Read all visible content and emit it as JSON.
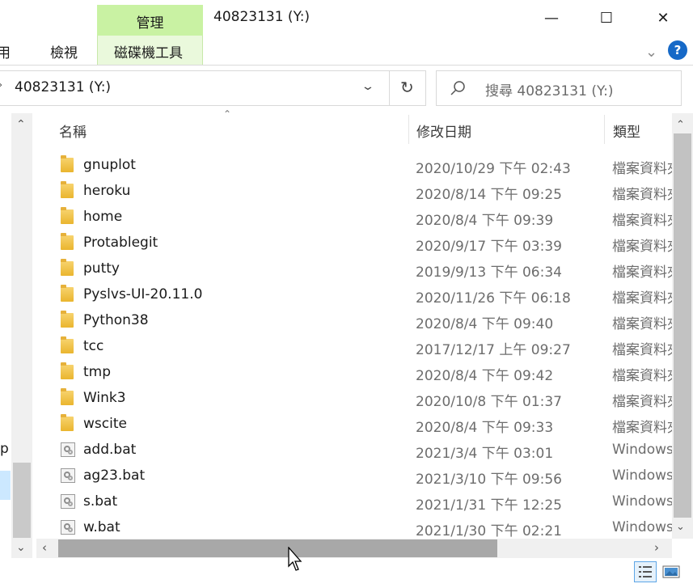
{
  "window": {
    "title": "40823131 (Y:)",
    "context_tab": "管理",
    "minimize": "—",
    "maximize": "☐",
    "close": "✕"
  },
  "ribbon": {
    "tabs": [
      "用",
      "檢視",
      "磁碟機工具"
    ],
    "expand": "⌄",
    "help": "?"
  },
  "address": {
    "chevron": "›",
    "path": "40823131 (Y:)",
    "dropdown": "⌄",
    "refresh": "↻"
  },
  "search": {
    "placeholder": "搜尋 40823131 (Y:)"
  },
  "nav": {
    "partial_label": "p",
    "up": "⌃",
    "down": "⌄"
  },
  "columns": {
    "name": "名稱",
    "date": "修改日期",
    "type": "類型",
    "sort_indicator": "⌃"
  },
  "files": [
    {
      "name": "gnuplot",
      "date": "2020/10/29 下午 02:43",
      "type": "檔案資料夾",
      "kind": "folder"
    },
    {
      "name": "heroku",
      "date": "2020/8/14 下午 09:25",
      "type": "檔案資料夾",
      "kind": "folder"
    },
    {
      "name": "home",
      "date": "2020/8/4 下午 09:39",
      "type": "檔案資料夾",
      "kind": "folder"
    },
    {
      "name": "Protablegit",
      "date": "2020/9/17 下午 03:39",
      "type": "檔案資料夾",
      "kind": "folder"
    },
    {
      "name": "putty",
      "date": "2019/9/13 下午 06:34",
      "type": "檔案資料夾",
      "kind": "folder"
    },
    {
      "name": "Pyslvs-UI-20.11.0",
      "date": "2020/11/26 下午 06:18",
      "type": "檔案資料夾",
      "kind": "folder"
    },
    {
      "name": "Python38",
      "date": "2020/8/4 下午 09:40",
      "type": "檔案資料夾",
      "kind": "folder"
    },
    {
      "name": "tcc",
      "date": "2017/12/17 上午 09:27",
      "type": "檔案資料夾",
      "kind": "folder"
    },
    {
      "name": "tmp",
      "date": "2020/8/4 下午 09:42",
      "type": "檔案資料夾",
      "kind": "folder"
    },
    {
      "name": "Wink3",
      "date": "2020/10/8 下午 01:37",
      "type": "檔案資料夾",
      "kind": "folder"
    },
    {
      "name": "wscite",
      "date": "2020/8/4 下午 09:33",
      "type": "檔案資料夾",
      "kind": "folder"
    },
    {
      "name": "add.bat",
      "date": "2021/3/4 下午 03:01",
      "type": "Windows",
      "kind": "bat"
    },
    {
      "name": "ag23.bat",
      "date": "2021/3/10 下午 09:56",
      "type": "Windows",
      "kind": "bat"
    },
    {
      "name": "s.bat",
      "date": "2021/1/31 下午 12:25",
      "type": "Windows",
      "kind": "bat"
    },
    {
      "name": "w.bat",
      "date": "2021/1/30 下午 02:21",
      "type": "Windows",
      "kind": "bat"
    }
  ],
  "scrollbars": {
    "up": "⌃",
    "down": "⌄",
    "left": "‹",
    "right": "›"
  },
  "icons": {
    "folder": "folder-icon",
    "bat": "batch-file-icon",
    "search": "search-icon"
  }
}
